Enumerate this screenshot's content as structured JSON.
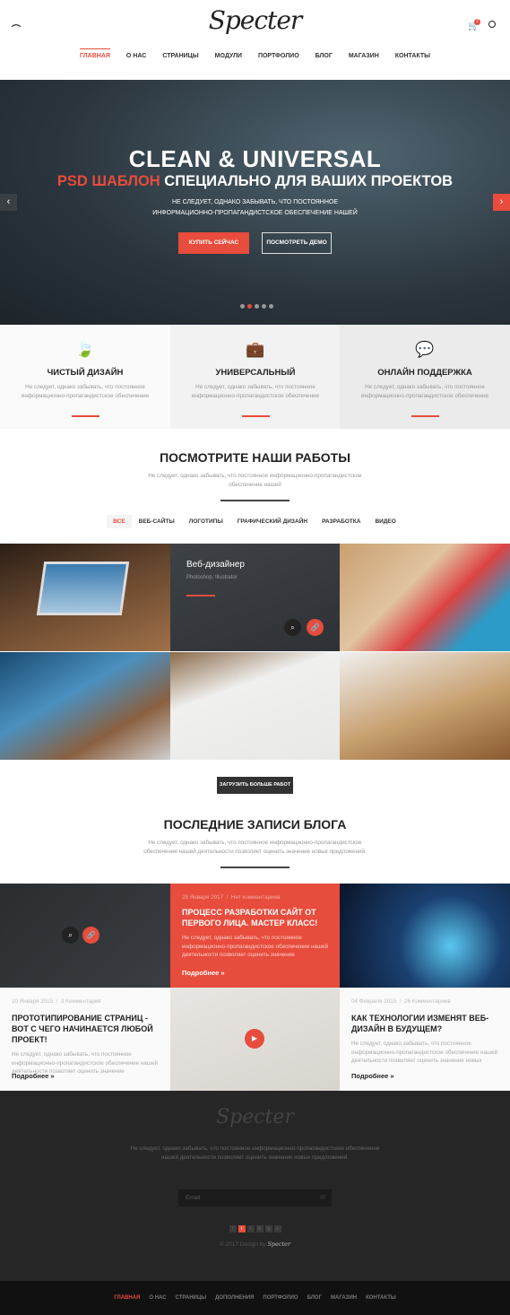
{
  "header": {
    "logo": "Specter",
    "cart_count": "2",
    "nav": [
      "ГЛАВНАЯ",
      "О НАС",
      "СТРАНИЦЫ",
      "МОДУЛИ",
      "ПОРТФОЛИО",
      "БЛОГ",
      "МАГАЗИН",
      "КОНТАКТЫ"
    ]
  },
  "hero": {
    "title": "CLEAN & UNIVERSAL",
    "subtitle_accent": "PSD ШАБЛОН",
    "subtitle_rest": "СПЕЦИАЛЬНО ДЛЯ ВАШИХ ПРОЕКТОВ",
    "text_line1": "НЕ СЛЕДУЕТ, ОДНАКО ЗАБЫВАТЬ, ЧТО ПОСТОЯННОЕ",
    "text_line2": "ИНФОРМАЦИОННО-ПРОПАГАНДИСТСКОЕ ОБЕСПЕЧЕНИЕ НАШЕЙ",
    "buy_label": "КУПИТЬ СЕЙЧАС",
    "demo_label": "ПОСМОТРЕТЬ ДЕМО",
    "slides": 5,
    "active_slide": 2
  },
  "features": [
    {
      "icon": "leaf-icon",
      "title": "ЧИСТЫЙ ДИЗАЙН",
      "text": "Не следует, однако забывать, что постоянное информационно-пропагандистское обеспечение"
    },
    {
      "icon": "briefcase-icon",
      "title": "УНИВЕРСАЛЬНЫЙ",
      "text": "Не следует, однако забывать, что постоянное информационно-пропагандистское обеспечение"
    },
    {
      "icon": "chat-icon",
      "title": "ОНЛАЙН ПОДДЕРЖКА",
      "text": "Не следует, однако забывать, что постоянное информационно-пропагандистское обеспечение"
    }
  ],
  "works": {
    "title": "ПОСМОТРИТЕ НАШИ РАБОТЫ",
    "subtitle": "Не следует, однако забывать, что постоянное информационно-пропагандистское обеспечение нашей",
    "filters": [
      "ВСЕ",
      "ВЕБ-САЙТЫ",
      "ЛОГОТИПЫ",
      "ГРАФИЧЕСКИЙ ДИЗАЙН",
      "РАЗРАБОТКА",
      "ВИДЕО"
    ],
    "hover_title": "Веб-дизайнер",
    "hover_sub": "Photoshop, Illustrator",
    "load_more": "ЗАГРУЗИТЬ БОЛЬШЕ РАБОТ"
  },
  "blog": {
    "title": "ПОСЛЕДНИЕ ЗАПИСИ БЛОГА",
    "subtitle": "Не следует, однако забывать, что постоянное информационно-пропагандистское обеспечение нашей деятельности позволяет оценить значение новых предложений.",
    "posts": [
      {
        "date": "28 Января 2017",
        "comments": "Нет комментариев",
        "title": "ПРОЦЕСС РАЗРАБОТКИ САЙТ ОТ ПЕРВОГО ЛИЦА. МАСТЕР КЛАСС!",
        "text": "Не следует, однако забывать, что постоянное информационно-пропагандистское обеспечение нашей деятельности позволяет оценить значение",
        "more": "Подробнее »"
      },
      {
        "date": "10 Января 2015",
        "comments": "3 Комментария",
        "title": "ПРОТОТИПИРОВАНИЕ СТРАНИЦ - ВОТ С ЧЕГО НАЧИНАЕТСЯ ЛЮБОЙ ПРОЕКТ!",
        "text": "Не следует, однако забывать, что постоянное информационно-пропагандистское обеспечение нашей деятельности позволяет оценить значение",
        "more": "Подробнее »"
      },
      {
        "date": "04 Февраля 2015",
        "comments": "26 Комментариев",
        "title": "КАК ТЕХНОЛОГИИ ИЗМЕНЯТ ВЕБ-ДИЗАЙН В БУДУЩЕМ?",
        "text": "Не следует, однако забывать, что постоянное информационно-пропагандистское обеспечение нашей деятельности позволяет оценить значение новых",
        "more": "Подробнее »"
      }
    ]
  },
  "footer": {
    "logo": "Specter",
    "text": "Не следует, однако забывать, что постоянное информационно-пропагандистское обеспечение нашей деятельности позволяет оценить значение новых предложений.",
    "email_placeholder": "Email",
    "copyright": "© 2017 Design by",
    "brand": "Specter",
    "nav": [
      "ГЛАВНАЯ",
      "О НАС",
      "СТРАНИЦЫ",
      "ДОПОЛНЕНИЯ",
      "ПОРТФОЛИО",
      "БЛОГ",
      "МАГАЗИН",
      "КОНТАКТЫ"
    ]
  },
  "colors": {
    "accent": "#e74c3c",
    "dark": "#262626"
  }
}
